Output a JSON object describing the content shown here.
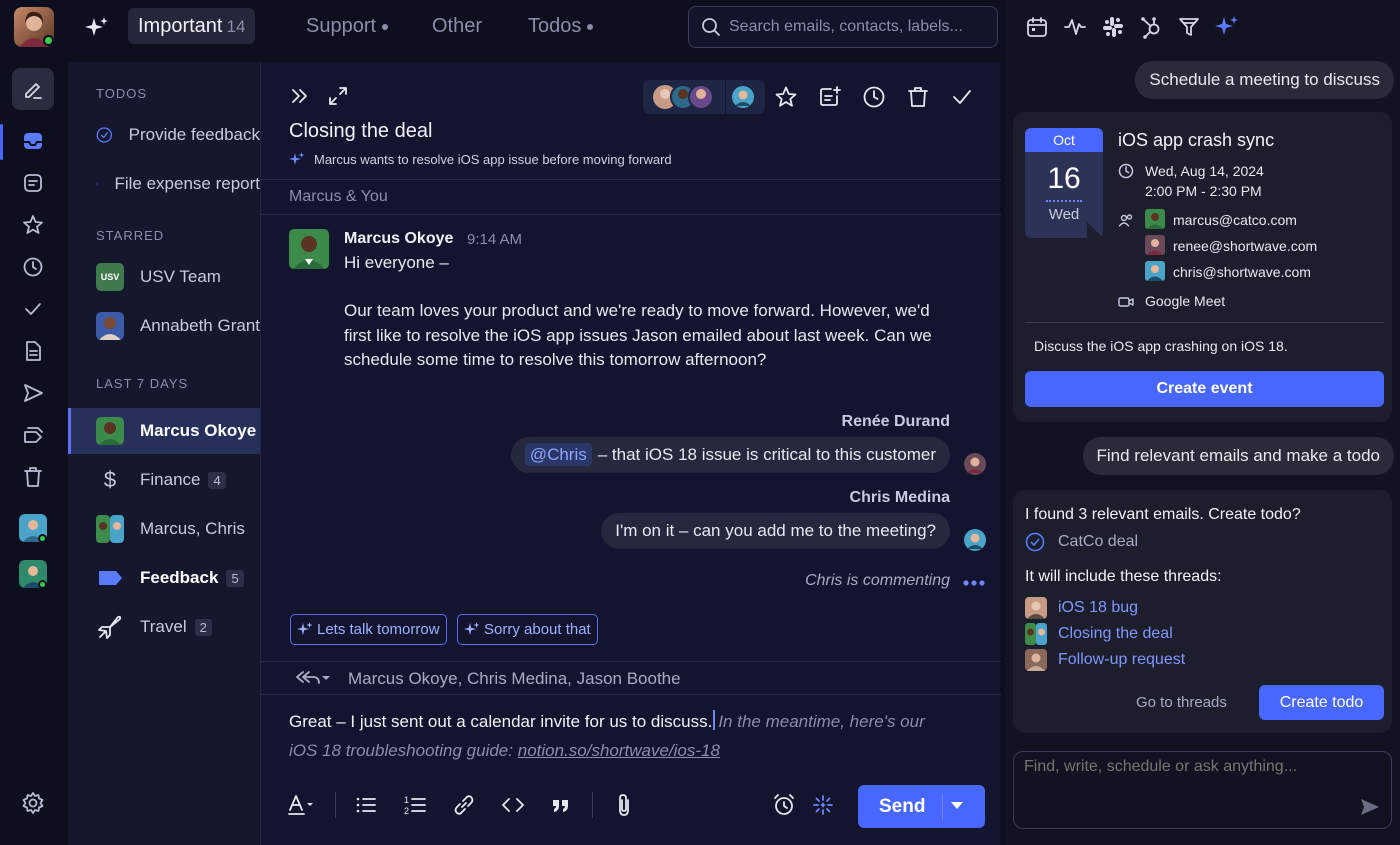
{
  "top": {
    "tabs": [
      {
        "label": "Important",
        "count": "14"
      },
      {
        "label": "Support"
      },
      {
        "label": "Other"
      },
      {
        "label": "Todos"
      }
    ],
    "search_placeholder": "Search emails, contacts, labels..."
  },
  "folders": {
    "todos_header": "TODOS",
    "todos": [
      "Provide feedback",
      "File expense report"
    ],
    "starred_header": "STARRED",
    "starred": [
      {
        "label": "USV Team",
        "avatar_text": "USV"
      },
      {
        "label": "Annabeth Grant"
      }
    ],
    "last7_header": "LAST 7 DAYS",
    "last7": [
      {
        "label": "Marcus Okoye"
      },
      {
        "label": "Finance",
        "count": "4"
      },
      {
        "label": "Marcus, Chris"
      },
      {
        "label": "Feedback",
        "count": "5"
      },
      {
        "label": "Travel",
        "count": "2"
      }
    ]
  },
  "thread": {
    "subject": "Closing the deal",
    "ai_summary": "Marcus wants to resolve iOS app issue before moving forward",
    "participants": "Marcus & You",
    "message": {
      "sender": "Marcus Okoye",
      "time": "9:14 AM",
      "greeting": "Hi everyone –",
      "line1": "Our team loves your product and we're ready to move forward. However, we'd",
      "line2": "first like to resolve the iOS app issues Jason emailed about last week. Can we",
      "line3": "schedule some time to resolve this tomorrow afternoon?"
    },
    "comments": [
      {
        "author": "Renée Durand",
        "mention": "@Chris",
        "text": "– that iOS 18 issue is critical to this customer"
      },
      {
        "author": "Chris Medina",
        "text": "I'm on it – can you add me to the meeting?"
      }
    ],
    "typing": "Chris is commenting",
    "suggestions": [
      "Lets talk tomorrow",
      "Sorry about that"
    ],
    "reply_to": "Marcus Okoye, Chris Medina, Jason Boothe",
    "draft_typed": "Great – I just sent out a calendar invite for us to discuss.",
    "draft_ghost": "In the meantime, here's our",
    "draft_ghost2": "iOS 18 troubleshooting guide:",
    "draft_link": "notion.so/shortwave/ios-18",
    "send_label": "Send"
  },
  "assistant": {
    "prompt1": "Schedule a meeting to discuss",
    "event": {
      "month": "Oct",
      "day": "16",
      "weekday": "Wed",
      "title": "iOS app crash sync",
      "date": "Wed, Aug 14, 2024",
      "time": "2:00 PM - 2:30 PM",
      "attendees": [
        "marcus@catco.com",
        "renee@shortwave.com",
        "chris@shortwave.com"
      ],
      "location": "Google Meet",
      "description": "Discuss the iOS app crashing on iOS 18.",
      "create_label": "Create event"
    },
    "prompt2": "Find relevant emails and make a todo",
    "todo": {
      "intro": "I found 3 relevant emails. Create todo?",
      "todo_name": "CatCo deal",
      "include_label": "It will include these threads:",
      "threads": [
        "iOS 18 bug",
        "Closing the deal",
        "Follow-up request"
      ],
      "go_label": "Go to threads",
      "create_label": "Create todo"
    },
    "input_placeholder": "Find, write, schedule or ask anything..."
  },
  "colors": {
    "accent": "#4767ff",
    "bg": "#0d0e1e",
    "panel": "#13152e"
  }
}
